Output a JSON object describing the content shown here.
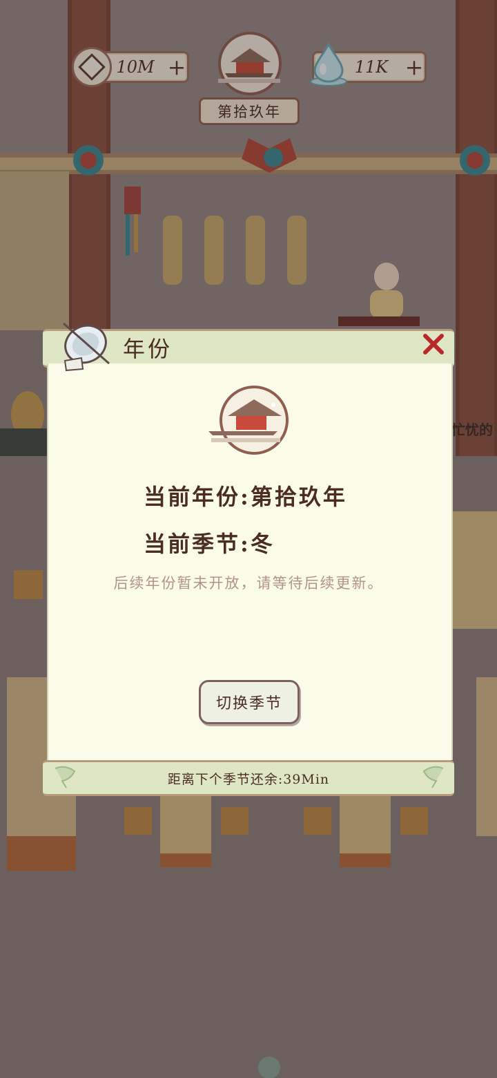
{
  "hud": {
    "coins": "10M",
    "water": "11K",
    "year_label": "第拾玖年"
  },
  "dialog": {
    "title": "年份",
    "current_year_label": "当前年份:",
    "current_year_value": "第拾玖年",
    "current_season_label": "当前季节:",
    "current_season_value": "冬",
    "note": "后续年份暂未开放，请等待后续更新。",
    "switch_button": "切换季节",
    "countdown": "距离下个季节还余:39Min"
  },
  "background": {
    "partial_sign_text": "忙忧的"
  },
  "colors": {
    "frame_brown": "#8e5e4f",
    "panel_cream": "#fbfbe9",
    "panel_green": "#dfe6c5",
    "text_dark": "#4b2c22",
    "close_red": "#b8282b"
  }
}
